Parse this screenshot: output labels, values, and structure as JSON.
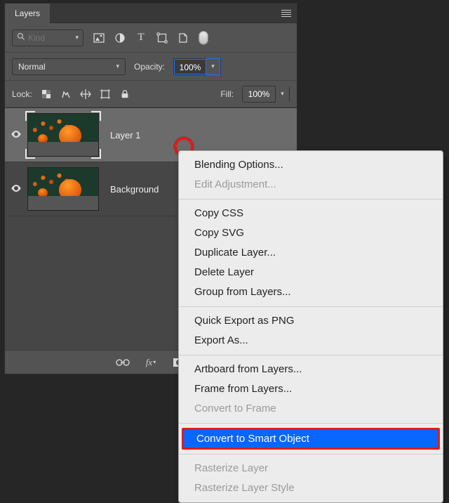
{
  "panel": {
    "title": "Layers",
    "filter_placeholder": "Kind",
    "blend_mode": "Normal",
    "opacity_label": "Opacity:",
    "opacity_value": "100%",
    "lock_label": "Lock:",
    "fill_label": "Fill:",
    "fill_value": "100%",
    "footer_fx": "fx"
  },
  "layers": [
    {
      "name": "Layer 1",
      "visible": true,
      "selected": true
    },
    {
      "name": "Background",
      "visible": true,
      "selected": false
    }
  ],
  "context_menu": {
    "groups": [
      [
        {
          "label": "Blending Options...",
          "enabled": true
        },
        {
          "label": "Edit Adjustment...",
          "enabled": false
        }
      ],
      [
        {
          "label": "Copy CSS",
          "enabled": true
        },
        {
          "label": "Copy SVG",
          "enabled": true
        },
        {
          "label": "Duplicate Layer...",
          "enabled": true
        },
        {
          "label": "Delete Layer",
          "enabled": true
        },
        {
          "label": "Group from Layers...",
          "enabled": true
        }
      ],
      [
        {
          "label": "Quick Export as PNG",
          "enabled": true
        },
        {
          "label": "Export As...",
          "enabled": true
        }
      ],
      [
        {
          "label": "Artboard from Layers...",
          "enabled": true
        },
        {
          "label": "Frame from Layers...",
          "enabled": true
        },
        {
          "label": "Convert to Frame",
          "enabled": false
        }
      ],
      [
        {
          "label": "Convert to Smart Object",
          "enabled": true,
          "highlighted": true
        }
      ],
      [
        {
          "label": "Rasterize Layer",
          "enabled": false
        },
        {
          "label": "Rasterize Layer Style",
          "enabled": false
        }
      ]
    ]
  }
}
